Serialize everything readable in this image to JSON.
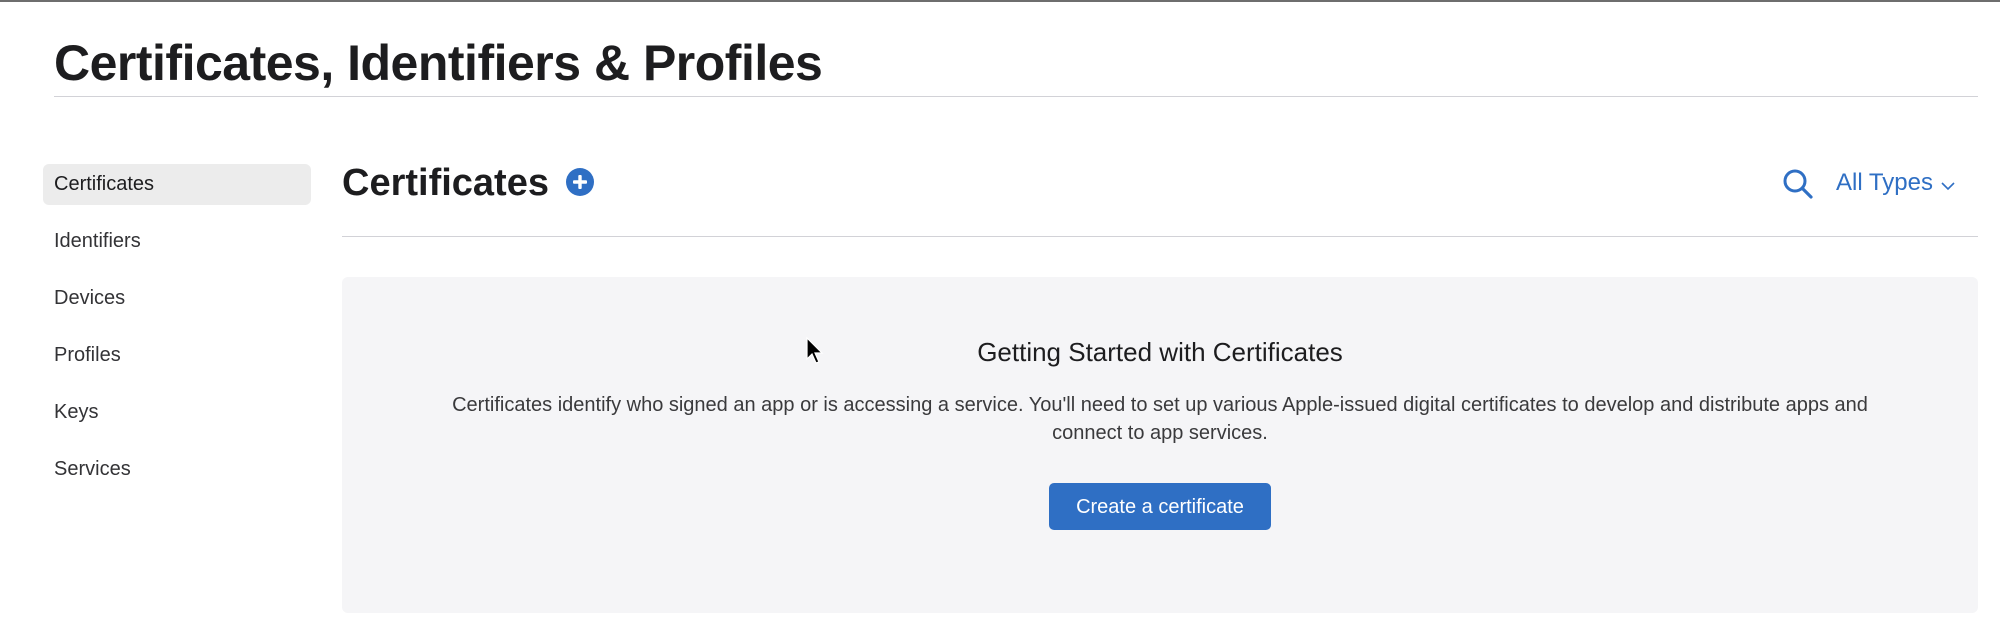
{
  "page": {
    "title": "Certificates, Identifiers & Profiles"
  },
  "sidebar": {
    "items": [
      {
        "label": "Certificates",
        "active": true
      },
      {
        "label": "Identifiers",
        "active": false
      },
      {
        "label": "Devices",
        "active": false
      },
      {
        "label": "Profiles",
        "active": false
      },
      {
        "label": "Keys",
        "active": false
      },
      {
        "label": "Services",
        "active": false
      }
    ]
  },
  "main": {
    "title": "Certificates",
    "add_icon": "plus-circle-icon",
    "search_icon": "search-icon",
    "filter": {
      "selected": "All Types",
      "icon": "chevron-down-icon"
    }
  },
  "empty_state": {
    "heading": "Getting Started with Certificates",
    "description": "Certificates identify who signed an app or is accessing a service. You'll need to set up various Apple-issued digital certificates to develop and distribute apps and connect to app services.",
    "button_label": "Create a certificate"
  },
  "colors": {
    "accent": "#2f6fc4",
    "active_sidebar_bg": "#ececec",
    "panel_bg": "#f5f5f7",
    "title_text": "#1d1d1f"
  }
}
